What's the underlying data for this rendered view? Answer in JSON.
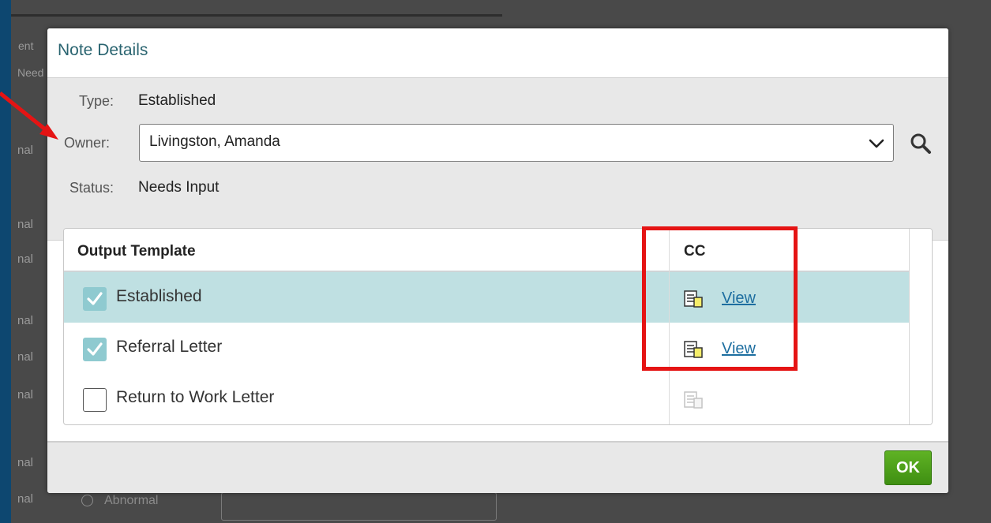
{
  "background": {
    "fragments": [
      "ent",
      "Need",
      "nal",
      "nal",
      "nal",
      "nal",
      "nal",
      "nal",
      "nal",
      "nal"
    ],
    "radio_label": "Abnormal"
  },
  "dialog": {
    "title": "Note Details",
    "type_label": "Type:",
    "type_value": "Established",
    "owner_label": "Owner:",
    "owner_value": "Livingston, Amanda",
    "status_label": "Status:",
    "status_value": "Needs Input",
    "grid": {
      "columns": [
        "Output Template",
        "CC"
      ],
      "rows": [
        {
          "label": "Established",
          "checked": true,
          "selected": true,
          "link": "View"
        },
        {
          "label": "Referral Letter",
          "checked": true,
          "selected": false,
          "link": "View"
        },
        {
          "label": "Return to Work Letter",
          "checked": false,
          "selected": false,
          "link": ""
        }
      ]
    },
    "ok_label": "OK"
  },
  "icons": {
    "owner_dropdown": "chevron-down-icon",
    "owner_search": "search-icon",
    "cc_document": "document-icon",
    "check": "checkmark-icon"
  },
  "colors": {
    "title": "#2a6470",
    "selected_row": "#bfe0e2",
    "checkbox_on": "#8fcad0",
    "link": "#1d6ea0",
    "ok_button": "#4e9f1a",
    "annotation": "#e51414"
  }
}
